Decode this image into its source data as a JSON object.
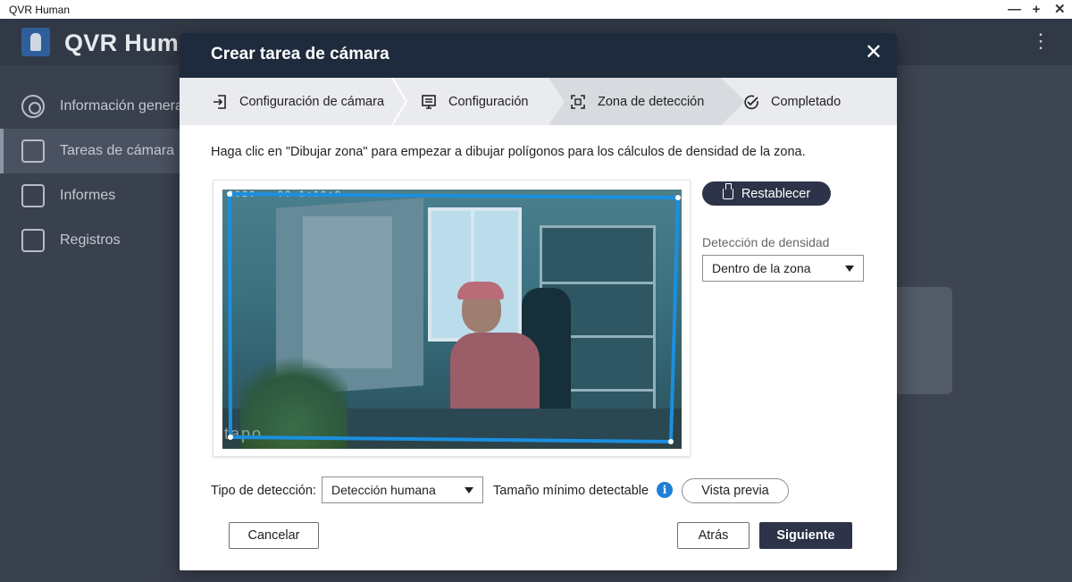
{
  "window": {
    "title": "QVR Human",
    "controls": {
      "minimize": "—",
      "maximize": "+",
      "close": "✕"
    }
  },
  "app": {
    "name": "QVR Human",
    "menu_icon": "⋮",
    "sidebar": {
      "items": [
        {
          "label": "Información general",
          "icon": "dashboard-icon",
          "active": false
        },
        {
          "label": "Tareas de cámara",
          "icon": "task-board-icon",
          "active": true
        },
        {
          "label": "Informes",
          "icon": "bar-chart-icon",
          "active": false
        },
        {
          "label": "Registros",
          "icon": "clipboard-icon",
          "active": false
        }
      ]
    }
  },
  "modal": {
    "title": "Crear tarea de cámara",
    "close_icon": "✕",
    "steps": [
      {
        "label": "Configuración de cámara",
        "icon": "login-arrow-icon",
        "active": false
      },
      {
        "label": "Configuración",
        "icon": "monitor-settings-icon",
        "active": false
      },
      {
        "label": "Zona de detección",
        "icon": "scan-frame-icon",
        "active": true
      },
      {
        "label": "Completado",
        "icon": "check-circle-icon",
        "active": false
      }
    ],
    "instruction": "Haga clic en \"Dibujar zona\" para empezar a dibujar polígonos para los cálculos de densidad de la zona.",
    "preview": {
      "timestamp": "2020-  -00  1:10:0",
      "watermark": "tapo",
      "zone_color": "#1a8fe0"
    },
    "reset_button": "Restablecer",
    "density": {
      "label": "Detección de densidad",
      "selected": "Dentro de la zona"
    },
    "detection_type": {
      "label": "Tipo de detección:",
      "selected": "Detección humana"
    },
    "min_size_label": "Tamaño mínimo detectable",
    "info_icon": "i",
    "preview_button": "Vista previa",
    "buttons": {
      "cancel": "Cancelar",
      "back": "Atrás",
      "next": "Siguiente"
    }
  }
}
